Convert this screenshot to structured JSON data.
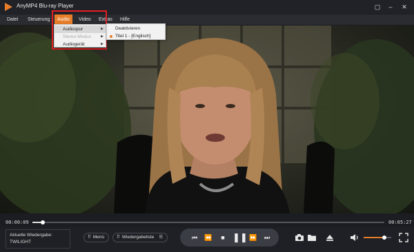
{
  "window": {
    "title": "AnyMP4 Blu-ray Player",
    "logo_color": "#e87d2a",
    "controls": [
      "chat-icon",
      "minimize-icon",
      "close-icon"
    ]
  },
  "menubar": {
    "items": [
      {
        "label": "Datei"
      },
      {
        "label": "Steuerung"
      },
      {
        "label": "Audio",
        "active": true
      },
      {
        "label": "Video"
      },
      {
        "label": "Extras"
      },
      {
        "label": "Hilfe"
      }
    ]
  },
  "audio_menu": {
    "items": [
      {
        "label": "Audiospur",
        "submenu": true,
        "hovered": true
      },
      {
        "label": "Stereo-Modus",
        "submenu": true,
        "disabled": true
      },
      {
        "label": "Audiogerät",
        "submenu": true
      }
    ]
  },
  "audiospur_submenu": {
    "items": [
      {
        "label": "Deaktivieren",
        "selected": false
      },
      {
        "label": "Titel 1 - [Englisch]",
        "selected": true
      }
    ]
  },
  "highlight_color": "#e31d24",
  "playback": {
    "elapsed": "00:00:09",
    "total": "00:05:27",
    "progress_fraction": 0.03
  },
  "now_playing": {
    "label": "Aktuelle Wiedergabe:",
    "title": "TWILIGHT"
  },
  "buttons": {
    "menu_label": "Menü",
    "playlist_label": "Wiedergabeliste"
  },
  "transport_icons": [
    "skip-to-start-icon",
    "rewind-icon",
    "stop-icon",
    "pause-icon",
    "fast-forward-icon",
    "skip-to-end-icon"
  ],
  "volume": {
    "level_fraction": 0.75
  },
  "accent_color": "#e87d2a"
}
